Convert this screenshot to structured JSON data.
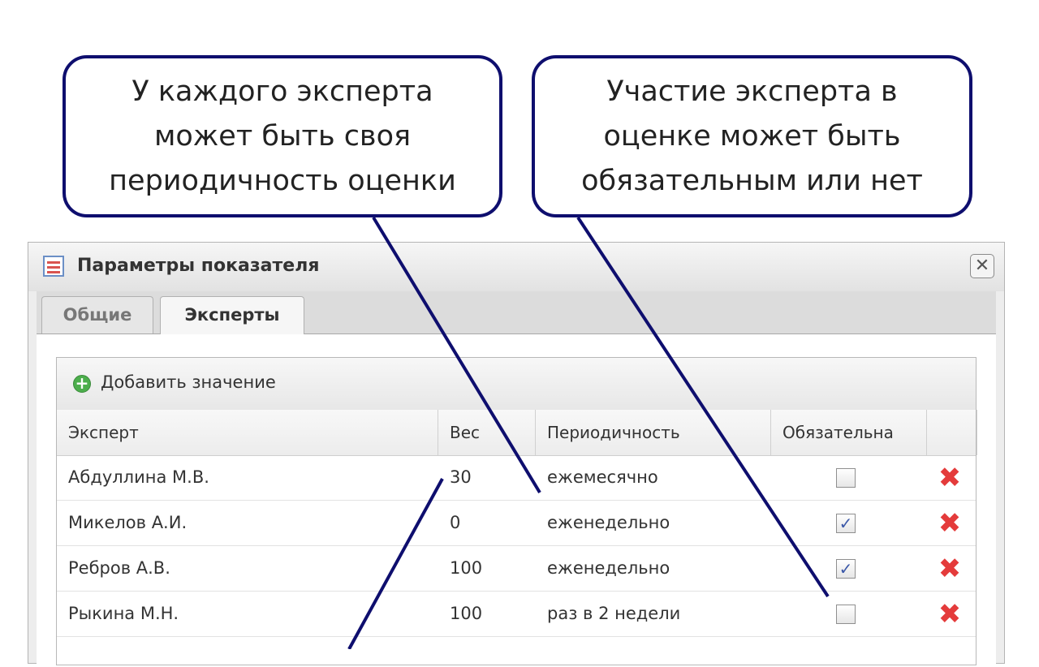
{
  "callouts": {
    "left": "У каждого эксперта\nможет быть своя\nпериодичность оценки",
    "right": "Участие эксперта в\nоценке может быть\nобязательным или нет"
  },
  "dialog": {
    "title": "Параметры показателя",
    "close_icon": "close-icon",
    "tabs": [
      "Общие",
      "Эксперты"
    ],
    "active_tab": "Эксперты"
  },
  "grid": {
    "add_label": "Добавить значение",
    "columns": [
      "Эксперт",
      "Вес",
      "Периодичность",
      "Обязательна"
    ],
    "rows": [
      {
        "expert": "Абдуллина М.В.",
        "weight": "30",
        "period": "ежемесячно",
        "required": false
      },
      {
        "expert": "Микелов А.И.",
        "weight": "0",
        "period": "еженедельно",
        "required": true
      },
      {
        "expert": "Ребров А.В.",
        "weight": "100",
        "period": "еженедельно",
        "required": true
      },
      {
        "expert": "Рыкина М.Н.",
        "weight": "100",
        "period": "раз в 2 недели",
        "required": false
      }
    ]
  },
  "colors": {
    "callout_border": "#0e0e6e",
    "delete": "#e43b3b",
    "add": "#4cae4c"
  }
}
